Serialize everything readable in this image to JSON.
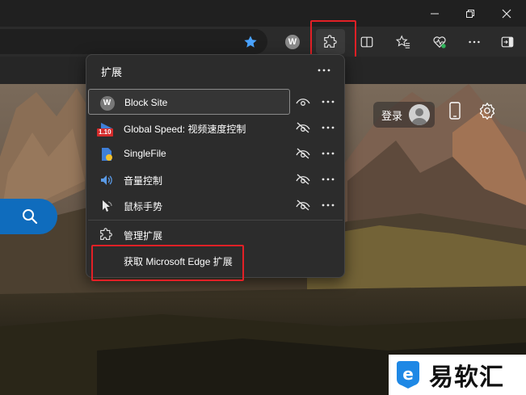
{
  "colors": {
    "accent": "#0f6cbd",
    "highlight_box": "#e32026",
    "popup_bg": "#2c2c2c",
    "toolbar_bg": "#2b2b2b"
  },
  "window_controls": [
    "minimize-icon",
    "restore-icon",
    "close-icon"
  ],
  "toolbar": {
    "icons": [
      "star-icon",
      "w-extension-icon",
      "extensions-puzzle-icon",
      "split-screen-icon",
      "favorites-icon",
      "browser-essentials-icon",
      "more-icon",
      "sidebar-icon"
    ],
    "w_avatar_letter": "W"
  },
  "page": {
    "login_label": "登录"
  },
  "extensions_menu": {
    "title": "扩展",
    "items": [
      {
        "label": "Block Site",
        "icon": "block-site-icon",
        "icon_letter": "W",
        "pinned": true
      },
      {
        "label": "Global Speed: 视频速度控制",
        "icon": "global-speed-icon",
        "badge": "1.10",
        "pinned": false
      },
      {
        "label": "SingleFile",
        "icon": "singlefile-icon",
        "pinned": false
      },
      {
        "label": "音量控制",
        "icon": "volume-icon",
        "pinned": false
      },
      {
        "label": "鼠标手势",
        "icon": "mouse-gesture-icon",
        "pinned": false
      }
    ],
    "manage_label": "管理扩展",
    "get_label": "获取 Microsoft Edge 扩展"
  },
  "watermark": {
    "text": "易软汇",
    "logo_letter": "e"
  }
}
